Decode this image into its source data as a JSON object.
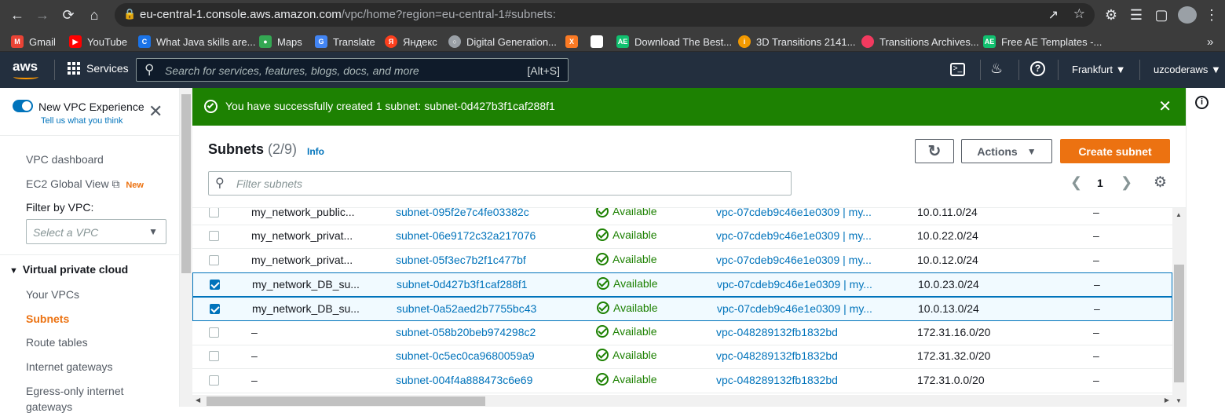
{
  "browser": {
    "url_host": "eu-central-1.console.aws.amazon.com",
    "url_path": "/vpc/home?region=eu-central-1#subnets:",
    "bookmarks": [
      {
        "label": "Gmail",
        "icon": "gmail-icon",
        "color": "#ea4335"
      },
      {
        "label": "YouTube",
        "icon": "youtube-icon",
        "color": "#ff0000"
      },
      {
        "label": "What Java skills are...",
        "icon": "bookmark-c-icon",
        "color": "#1a73e8"
      },
      {
        "label": "Maps",
        "icon": "maps-icon",
        "color": "#34a853"
      },
      {
        "label": "Translate",
        "icon": "translate-icon",
        "color": "#4285f4"
      },
      {
        "label": "Яндекс",
        "icon": "yandex-icon",
        "color": "#fc3f1d"
      },
      {
        "label": "Digital Generation...",
        "icon": "globe-icon",
        "color": "#9aa0a6"
      },
      {
        "label": "",
        "icon": "xampp-icon",
        "color": "#fb7a24"
      },
      {
        "label": "",
        "icon": "blank-page-icon",
        "color": "#ffffff"
      },
      {
        "label": "Download The Best...",
        "icon": "ae-icon",
        "color": "#10c06f"
      },
      {
        "label": "3D Transitions 2141...",
        "icon": "bookmark-i-icon",
        "color": "#f29900"
      },
      {
        "label": "Transitions Archives...",
        "icon": "bookmark-pink-icon",
        "color": "#f23a5f"
      },
      {
        "label": "Free AE Templates -...",
        "icon": "ae-icon",
        "color": "#10c06f"
      }
    ],
    "more_bookmarks": "»"
  },
  "aws_nav": {
    "logo": "aws",
    "services": "Services",
    "search_placeholder": "Search for services, features, blogs, docs, and more",
    "search_shortcut": "[Alt+S]",
    "region": "Frankfurt",
    "account": "uzcoderaws"
  },
  "sidebar": {
    "toggle_label": "New VPC Experience",
    "toggle_sub": "Tell us what you think",
    "items": [
      {
        "label": "VPC dashboard"
      },
      {
        "label": "EC2 Global View",
        "badge": "New"
      },
      {
        "label": "Filter by VPC:"
      }
    ],
    "vpc_select_placeholder": "Select a VPC",
    "section": "Virtual private cloud",
    "section_items": [
      "Your VPCs",
      "Subnets",
      "Route tables",
      "Internet gateways",
      "Egress-only internet",
      "gateways"
    ],
    "active": "Subnets"
  },
  "flash": {
    "message": "You have successfully created 1 subnet: subnet-0d427b3f1caf288f1"
  },
  "panel": {
    "title": "Subnets",
    "count": "(2/9)",
    "info": "Info",
    "actions_label": "Actions",
    "create_label": "Create subnet",
    "filter_placeholder": "Filter subnets",
    "page": "1"
  },
  "rows": [
    {
      "name": "my_network_public...",
      "id": "subnet-095f2e7c4fe03382c",
      "state": "Available",
      "vpc": "vpc-07cdeb9c46e1e0309 | my...",
      "cidr": "10.0.11.0/24",
      "extra": "–",
      "selected": false
    },
    {
      "name": "my_network_privat...",
      "id": "subnet-06e9172c32a217076",
      "state": "Available",
      "vpc": "vpc-07cdeb9c46e1e0309 | my...",
      "cidr": "10.0.22.0/24",
      "extra": "–",
      "selected": false
    },
    {
      "name": "my_network_privat...",
      "id": "subnet-05f3ec7b2f1c477bf",
      "state": "Available",
      "vpc": "vpc-07cdeb9c46e1e0309 | my...",
      "cidr": "10.0.12.0/24",
      "extra": "–",
      "selected": false
    },
    {
      "name": "my_network_DB_su...",
      "id": "subnet-0d427b3f1caf288f1",
      "state": "Available",
      "vpc": "vpc-07cdeb9c46e1e0309 | my...",
      "cidr": "10.0.23.0/24",
      "extra": "–",
      "selected": true
    },
    {
      "name": "my_network_DB_su...",
      "id": "subnet-0a52aed2b7755bc43",
      "state": "Available",
      "vpc": "vpc-07cdeb9c46e1e0309 | my...",
      "cidr": "10.0.13.0/24",
      "extra": "–",
      "selected": true
    },
    {
      "name": "–",
      "id": "subnet-058b20beb974298c2",
      "state": "Available",
      "vpc": "vpc-048289132fb1832bd",
      "cidr": "172.31.16.0/20",
      "extra": "–",
      "selected": false
    },
    {
      "name": "–",
      "id": "subnet-0c5ec0ca9680059a9",
      "state": "Available",
      "vpc": "vpc-048289132fb1832bd",
      "cidr": "172.31.32.0/20",
      "extra": "–",
      "selected": false
    },
    {
      "name": "–",
      "id": "subnet-004f4a888473c6e69",
      "state": "Available",
      "vpc": "vpc-048289132fb1832bd",
      "cidr": "172.31.0.0/20",
      "extra": "–",
      "selected": false
    }
  ]
}
